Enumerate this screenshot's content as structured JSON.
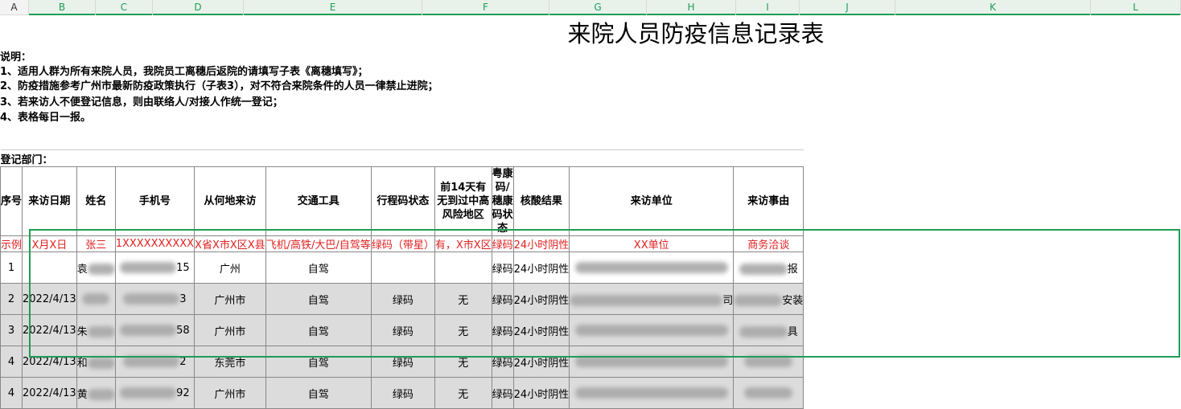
{
  "columns": [
    "A",
    "B",
    "C",
    "D",
    "E",
    "F",
    "G",
    "H",
    "I",
    "J",
    "K",
    "L"
  ],
  "selected_columns": [
    "B",
    "C",
    "D",
    "E",
    "F",
    "G",
    "H",
    "I",
    "J",
    "K",
    "L"
  ],
  "sheet": {
    "title": "来院人员防疫信息记录表",
    "notes": [
      "说明：",
      "1、适用人群为所有来院人员，我院员工离穗后返院的请填写子表《离穗填写》；",
      "2、防疫措施参考广州市最新防疫政策执行（子表3），对不符合来院条件的人员一律禁止进院；",
      "3、若来访人不便登记信息，则由联络人/对接人作统一登记；",
      "4、表格每日一报。"
    ],
    "department_label": "登记部门：",
    "headers": [
      "序号",
      "来访日期",
      "姓名",
      "手机号",
      "从何地来访",
      "交通工具",
      "行程码状态",
      "前14天有无到过中高风险地区",
      "粤康码/穗康码状态",
      "核酸结果",
      "来访单位",
      "来访事由"
    ],
    "example": [
      "示例",
      "X月X日",
      "张三",
      "1XXXXXXXXXX",
      "X省X市X区X县",
      "飞机/高铁/大巴/自驾等",
      "绿码（带星）",
      "有，X市X区",
      "绿码",
      "24小时阴性",
      "XX单位",
      "商务洽谈"
    ],
    "rows": [
      {
        "no": "1",
        "date": "",
        "name": "袁",
        "phone": "15",
        "from": "广州",
        "transport": "自驾",
        "trip_code": "",
        "risk": "",
        "health_code": "绿码",
        "nucleic": "24小时阴性",
        "unit": "",
        "reason": "报"
      },
      {
        "no": "2",
        "date": "2022/4/13",
        "name": "",
        "phone": "3",
        "from": "广州市",
        "transport": "自驾",
        "trip_code": "绿码",
        "risk": "无",
        "health_code": "绿码",
        "nucleic": "24小时阴性",
        "unit": "司",
        "reason": "安装"
      },
      {
        "no": "3",
        "date": "2022/4/13",
        "name": "朱",
        "phone": "58",
        "from": "广州市",
        "transport": "自驾",
        "trip_code": "绿码",
        "risk": "无",
        "health_code": "绿码",
        "nucleic": "24小时阴性",
        "unit": "",
        "reason": "具"
      },
      {
        "no": "4",
        "date": "2022/4/13",
        "name": "和",
        "phone": "2",
        "from": "东莞市",
        "transport": "自驾",
        "trip_code": "绿码",
        "risk": "无",
        "health_code": "绿码",
        "nucleic": "24小时阴性",
        "unit": "",
        "reason": ""
      },
      {
        "no": "4",
        "date": "2022/4/13",
        "name": "黄",
        "phone": "92",
        "from": "广州市",
        "transport": "自驾",
        "trip_code": "绿码",
        "risk": "无",
        "health_code": "绿码",
        "nucleic": "24小时阴性",
        "unit": "",
        "reason": ""
      }
    ]
  },
  "colors": {
    "accent": "#1f9d55",
    "example_text": "#e02020",
    "selected_row_bg": "#dcdcdc"
  }
}
